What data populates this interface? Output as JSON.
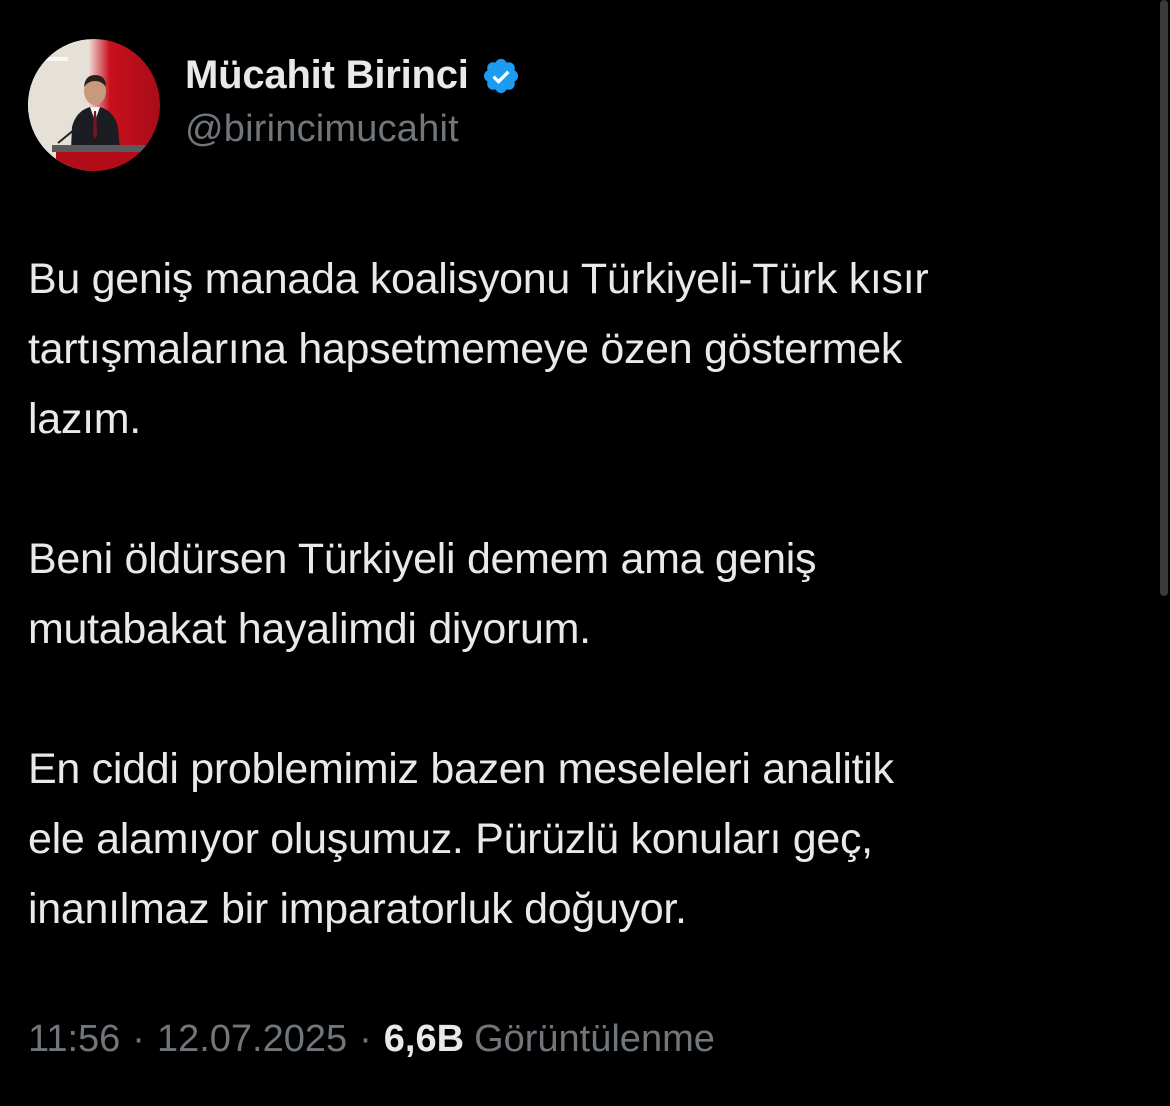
{
  "author": {
    "display_name": "Mücahit Birinci",
    "handle": "@birincimucahit",
    "verified": true,
    "verified_color": "#1d9bf0"
  },
  "tweet": {
    "paragraphs": [
      "Bu geniş manada koalisyonu Türkiyeli-Türk kısır\ntartışmalarına hapsetmemeye özen göstermek\nlazım.",
      "Beni öldürsen Türkiyeli demem ama geniş\nmutabakat hayalimdi diyorum.",
      "En ciddi problemimiz bazen meseleleri analitik\nele alamıyor oluşumuz. Pürüzlü konuları geç,\ninanılmaz bir imparatorluk doğuyor."
    ]
  },
  "meta": {
    "time": "11:56",
    "separator": "·",
    "date": "12.07.2025",
    "views_count": "6,6B",
    "views_label": "Görüntülenme"
  },
  "icons": {
    "verified": "verified-badge-icon"
  },
  "colors": {
    "background": "#000000",
    "primary_text": "#e7e9ea",
    "secondary_text": "#71767b"
  }
}
